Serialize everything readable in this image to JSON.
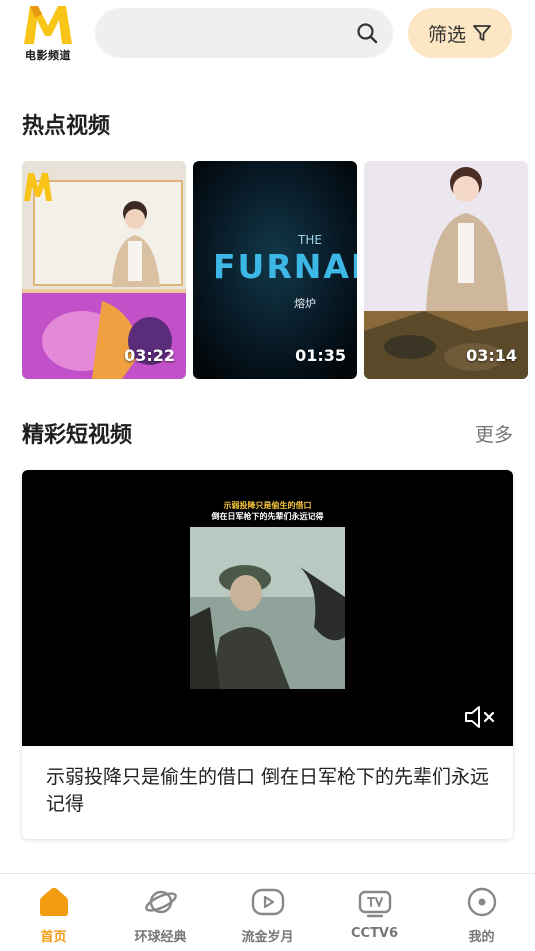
{
  "header": {
    "logo_text": "电影频道",
    "search_placeholder": "",
    "filter_label": "筛选"
  },
  "hot": {
    "title": "热点视频",
    "items": [
      {
        "duration": "03:22",
        "image": "presenter-with-animal-poster"
      },
      {
        "duration": "01:35",
        "image": "the-furnace-poster",
        "poster_title_top": "THE",
        "poster_title_main": "FURNAN",
        "poster_subtitle": "熔炉"
      },
      {
        "duration": "03:14",
        "image": "presenter-with-tank-still"
      }
    ]
  },
  "shorts": {
    "title": "精彩短视频",
    "more_label": "更多",
    "item": {
      "subtitle_line1": "示弱投降只是偷生的借口",
      "subtitle_line2": "倒在日军枪下的先辈们永远记得",
      "caption": "示弱投降只是偷生的借口 倒在日军枪下的先辈们永远记得",
      "muted": true
    }
  },
  "nav": {
    "items": [
      {
        "label": "首页",
        "icon": "home-icon",
        "active": true
      },
      {
        "label": "环球经典",
        "icon": "planet-icon",
        "active": false
      },
      {
        "label": "流金岁月",
        "icon": "play-icon",
        "active": false
      },
      {
        "label": "CCTV6",
        "icon": "tv-icon",
        "active": false
      },
      {
        "label": "我的",
        "icon": "profile-icon",
        "active": false
      }
    ]
  },
  "colors": {
    "accent": "#f39c12",
    "logo_yellow": "#f7c417",
    "filter_bg": "#fde6c4",
    "search_bg": "#efefef"
  }
}
